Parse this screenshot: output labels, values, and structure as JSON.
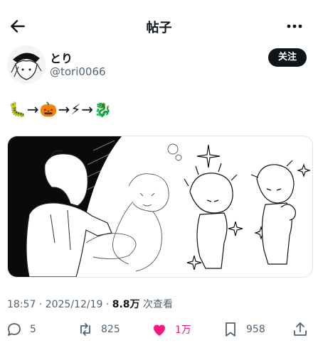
{
  "header": {
    "title": "帖子"
  },
  "author": {
    "name": "とり",
    "handle": "@tori0066",
    "follow_label": "关注"
  },
  "post": {
    "text": "🐛→🎃→⚡→🐉"
  },
  "meta": {
    "time_date": "18:57 · 2025/12/19 · ",
    "views": "8.8万",
    "views_label": " 次查看"
  },
  "actions": {
    "replies": "5",
    "reposts": "825",
    "likes": "1万",
    "bookmarks": "958"
  },
  "colors": {
    "like": "#f91880",
    "text": "#0f1419",
    "secondary": "#536471"
  }
}
